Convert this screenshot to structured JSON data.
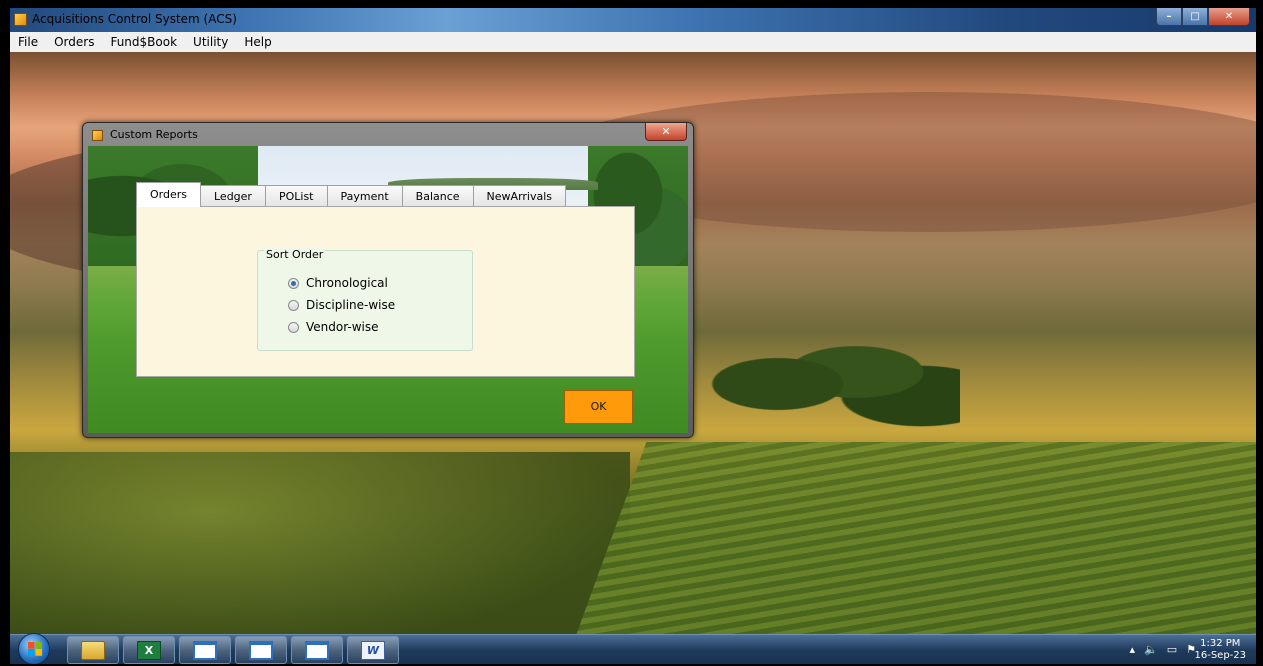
{
  "app": {
    "title": "Acquisitions Control System (ACS)"
  },
  "window_controls": {
    "minimize": "–",
    "maximize": "□",
    "close": "✕"
  },
  "menubar": {
    "items": [
      "File",
      "Orders",
      "Fund$Book",
      "Utility",
      "Help"
    ]
  },
  "dialog": {
    "title": "Custom Reports",
    "close_glyph": "✕",
    "tabs": [
      "Orders",
      "Ledger",
      "POList",
      "Payment",
      "Balance",
      "NewArrivals"
    ],
    "active_tab": "Orders",
    "group": {
      "legend": "Sort Order",
      "options": [
        {
          "label": "Chronological",
          "selected": true
        },
        {
          "label": "Discipline-wise",
          "selected": false
        },
        {
          "label": "Vendor-wise",
          "selected": false
        }
      ]
    },
    "ok_label": "OK",
    "ok_color": "#ff9a0a"
  },
  "taskbar": {
    "icons": [
      "windows-explorer-icon",
      "excel-icon",
      "window-icon",
      "window-icon",
      "window-icon",
      "word-icon"
    ],
    "excel_glyph": "X",
    "word_glyph": "W",
    "tray": {
      "up": "▴",
      "volume": "🔈",
      "network": "▭",
      "flag": "⚑"
    },
    "clock": {
      "time": "1:32 PM",
      "date": "16-Sep-23"
    }
  }
}
